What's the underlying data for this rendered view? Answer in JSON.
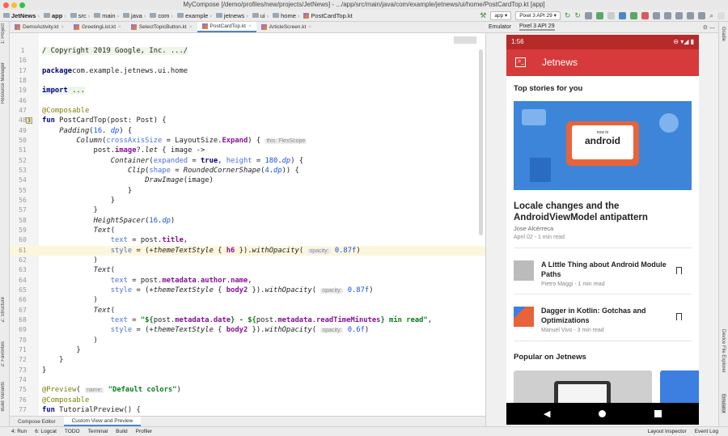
{
  "window": {
    "title": "MyCompose [/demo/profiles/new/projects/JetNews] - .../app/src/main/java/com/example/jetnews/ui/home/PostCardTop.kt [app]"
  },
  "breadcrumb": [
    "JetNews",
    "app",
    "src",
    "main",
    "java",
    "com",
    "example",
    "jetnews",
    "ui",
    "home",
    "PostCardTop.kt"
  ],
  "toolbar": {
    "run_config": "app",
    "device": "Pixel 3 API 29"
  },
  "tabs": [
    {
      "label": "DemoActivity.kt"
    },
    {
      "label": "GreetingList.kt"
    },
    {
      "label": "SelectTopicButton.kt"
    },
    {
      "label": "PostCardTop.kt",
      "active": true
    },
    {
      "label": "ArticleScreen.kt"
    }
  ],
  "left_tools": [
    "1: Project",
    "Resource Manager",
    "Z: Structure",
    "2: Favorites",
    "Build Variants"
  ],
  "right_tools": [
    "Gradle",
    "Device File Explorer",
    "Emulator"
  ],
  "code": [
    {
      "n": "1",
      "t": [
        [
          "fold",
          "/ Copyright 2019 Google, Inc. .../"
        ]
      ]
    },
    {
      "n": "16",
      "t": []
    },
    {
      "n": "17",
      "t": [
        [
          "kw",
          "package"
        ],
        [
          "",
          "com.example.jetnews.ui.home"
        ]
      ]
    },
    {
      "n": "18",
      "t": []
    },
    {
      "n": "19",
      "t": [
        [
          "kw fold",
          "import"
        ],
        [
          "fold",
          " ..."
        ]
      ]
    },
    {
      "n": "46",
      "t": []
    },
    {
      "n": "47",
      "t": [
        [
          "an",
          "@Composable"
        ]
      ]
    },
    {
      "n": "48",
      "badge": "3",
      "t": [
        [
          "kw",
          "fun"
        ],
        [
          "",
          " PostCardTop(post: Post) {"
        ]
      ]
    },
    {
      "n": "49",
      "t": [
        [
          "",
          "    "
        ],
        [
          "it",
          "Padding"
        ],
        [
          "",
          "("
        ],
        [
          "num",
          "16"
        ],
        [
          "",
          ". "
        ],
        [
          "num it",
          "dp"
        ],
        [
          "",
          ") {"
        ]
      ]
    },
    {
      "n": "50",
      "t": [
        [
          "",
          "        "
        ],
        [
          "it",
          "Column"
        ],
        [
          "",
          "("
        ],
        [
          "arg",
          "crossAxisSize"
        ],
        [
          "",
          " = LayoutSize."
        ],
        [
          "prop",
          "Expand"
        ],
        [
          "",
          ") { "
        ],
        [
          "hint",
          "this: FlexScope"
        ]
      ]
    },
    {
      "n": "51",
      "t": [
        [
          "",
          "            post."
        ],
        [
          "prop",
          "image"
        ],
        [
          "",
          "?."
        ],
        [
          "it",
          "let"
        ],
        [
          "",
          " { image ->"
        ]
      ]
    },
    {
      "n": "52",
      "t": [
        [
          "",
          "                "
        ],
        [
          "it",
          "Container"
        ],
        [
          "",
          "("
        ],
        [
          "arg",
          "expanded"
        ],
        [
          "",
          " = "
        ],
        [
          "kw",
          "true"
        ],
        [
          "",
          ", "
        ],
        [
          "arg",
          "height"
        ],
        [
          "",
          " = "
        ],
        [
          "num",
          "180"
        ],
        [
          "",
          "."
        ],
        [
          "num it",
          "dp"
        ],
        [
          "",
          ") {"
        ]
      ]
    },
    {
      "n": "53",
      "t": [
        [
          "",
          "                    "
        ],
        [
          "it",
          "Clip"
        ],
        [
          "",
          "("
        ],
        [
          "arg",
          "shape"
        ],
        [
          "",
          " = "
        ],
        [
          "it",
          "RoundedCornerShape"
        ],
        [
          "",
          "("
        ],
        [
          "num",
          "4"
        ],
        [
          "",
          "."
        ],
        [
          "num it",
          "dp"
        ],
        [
          "",
          ")) {"
        ]
      ]
    },
    {
      "n": "54",
      "t": [
        [
          "",
          "                        "
        ],
        [
          "it",
          "DrawImage"
        ],
        [
          "",
          "(image)"
        ]
      ]
    },
    {
      "n": "55",
      "t": [
        [
          "",
          "                    }"
        ]
      ]
    },
    {
      "n": "56",
      "t": [
        [
          "",
          "                }"
        ]
      ]
    },
    {
      "n": "57",
      "t": [
        [
          "",
          "            }"
        ]
      ]
    },
    {
      "n": "58",
      "t": [
        [
          "",
          "            "
        ],
        [
          "it",
          "HeightSpacer"
        ],
        [
          "",
          "("
        ],
        [
          "num",
          "16"
        ],
        [
          "",
          "."
        ],
        [
          "num it",
          "dp"
        ],
        [
          "",
          ")"
        ]
      ]
    },
    {
      "n": "59",
      "t": [
        [
          "",
          "            "
        ],
        [
          "it",
          "Text"
        ],
        [
          "",
          "("
        ]
      ]
    },
    {
      "n": "60",
      "t": [
        [
          "",
          "                "
        ],
        [
          "arg",
          "text"
        ],
        [
          "",
          " = post."
        ],
        [
          "prop",
          "title"
        ],
        [
          "",
          ","
        ]
      ]
    },
    {
      "n": "61",
      "cur": true,
      "t": [
        [
          "",
          "                "
        ],
        [
          "arg",
          "style"
        ],
        [
          "",
          " = (+"
        ],
        [
          "it",
          "themeTextStyle"
        ],
        [
          "",
          " { "
        ],
        [
          "prop",
          "h6"
        ],
        [
          "",
          " })."
        ],
        [
          "it",
          "withOpacity"
        ],
        [
          "",
          "( "
        ],
        [
          "hint",
          "opacity:"
        ],
        [
          "num",
          " 0.87f"
        ],
        [
          "",
          ")"
        ]
      ]
    },
    {
      "n": "62",
      "t": [
        [
          "",
          "            )"
        ]
      ]
    },
    {
      "n": "63",
      "t": [
        [
          "",
          "            "
        ],
        [
          "it",
          "Text"
        ],
        [
          "",
          "("
        ]
      ]
    },
    {
      "n": "64",
      "t": [
        [
          "",
          "                "
        ],
        [
          "arg",
          "text"
        ],
        [
          "",
          " = post."
        ],
        [
          "prop",
          "metadata"
        ],
        [
          "",
          "."
        ],
        [
          "prop",
          "author"
        ],
        [
          "",
          "."
        ],
        [
          "prop",
          "name"
        ],
        [
          "",
          ","
        ]
      ]
    },
    {
      "n": "65",
      "t": [
        [
          "",
          "                "
        ],
        [
          "arg",
          "style"
        ],
        [
          "",
          " = (+"
        ],
        [
          "it",
          "themeTextStyle"
        ],
        [
          "",
          " { "
        ],
        [
          "prop",
          "body2"
        ],
        [
          "",
          " })."
        ],
        [
          "it",
          "withOpacity"
        ],
        [
          "",
          "( "
        ],
        [
          "hint",
          "opacity:"
        ],
        [
          "num",
          " 0.87f"
        ],
        [
          "",
          ")"
        ]
      ]
    },
    {
      "n": "66",
      "t": [
        [
          "",
          "            )"
        ]
      ]
    },
    {
      "n": "67",
      "t": [
        [
          "",
          "            "
        ],
        [
          "it",
          "Text"
        ],
        [
          "",
          "("
        ]
      ]
    },
    {
      "n": "68",
      "t": [
        [
          "",
          "                "
        ],
        [
          "arg",
          "text"
        ],
        [
          "",
          " = "
        ],
        [
          "str",
          "\"${"
        ],
        [
          "",
          "post."
        ],
        [
          "prop",
          "metadata"
        ],
        [
          "",
          "."
        ],
        [
          "prop",
          "date"
        ],
        [
          "str",
          "} - ${"
        ],
        [
          "",
          "post."
        ],
        [
          "prop",
          "metadata"
        ],
        [
          "",
          "."
        ],
        [
          "prop",
          "readTimeMinutes"
        ],
        [
          "str",
          "} min read\""
        ],
        [
          "",
          ","
        ]
      ]
    },
    {
      "n": "69",
      "t": [
        [
          "",
          "                "
        ],
        [
          "arg",
          "style"
        ],
        [
          "",
          " = (+"
        ],
        [
          "it",
          "themeTextStyle"
        ],
        [
          "",
          " { "
        ],
        [
          "prop",
          "body2"
        ],
        [
          "",
          " })."
        ],
        [
          "it",
          "withOpacity"
        ],
        [
          "",
          "( "
        ],
        [
          "hint",
          "opacity:"
        ],
        [
          "num",
          " 0.6f"
        ],
        [
          "",
          ")"
        ]
      ]
    },
    {
      "n": "70",
      "t": [
        [
          "",
          "            )"
        ]
      ]
    },
    {
      "n": "71",
      "t": [
        [
          "",
          "        }"
        ]
      ]
    },
    {
      "n": "72",
      "t": [
        [
          "",
          "    }"
        ]
      ]
    },
    {
      "n": "73",
      "t": [
        [
          "",
          "}"
        ]
      ]
    },
    {
      "n": "74",
      "t": []
    },
    {
      "n": "75",
      "t": [
        [
          "an",
          "@Preview"
        ],
        [
          "",
          "( "
        ],
        [
          "hint",
          "name:"
        ],
        [
          "str",
          " \"Default colors\""
        ],
        [
          "",
          ")"
        ]
      ]
    },
    {
      "n": "76",
      "t": [
        [
          "an",
          "@Composable"
        ]
      ]
    },
    {
      "n": "77",
      "t": [
        [
          "kw",
          "fun"
        ],
        [
          "",
          " TutorialPreview() {"
        ]
      ]
    }
  ],
  "editor_tabs": [
    {
      "label": "Compose Editor"
    },
    {
      "label": "Custom View and Preview",
      "active": true
    }
  ],
  "status_tools": [
    "4: Run",
    "6: Logcat",
    "TODO",
    "Terminal",
    "Build",
    "Profiler"
  ],
  "status_right": [
    "Layout Inspector",
    "Event Log"
  ],
  "emulator": {
    "tabs": [
      "Emulator",
      "Pixel 3 API 29"
    ]
  },
  "phone": {
    "time": "1:56",
    "app_title": "Jetnews",
    "section1": "Top stories for you",
    "hero_badge_top": "now in",
    "hero_badge": "android",
    "top_title": "Locale changes and the AndroidViewModel antipattern",
    "top_author": "Jose Alcérreca",
    "top_meta": "April 02 - 1 min read",
    "items": [
      {
        "title": "A Little Thing about Android Module Paths",
        "meta": "Pietro Maggi - 1 min read"
      },
      {
        "title": "Dagger in Kotlin: Gotchas and Optimizations",
        "meta": "Manuel Vivo - 3 min read"
      }
    ],
    "section2": "Popular on Jetnews"
  },
  "colors": {
    "appbar": "#d63a3a",
    "statusbar": "#b72a2a",
    "accent": "#4a88c7",
    "current_line": "#fcf6dc"
  }
}
